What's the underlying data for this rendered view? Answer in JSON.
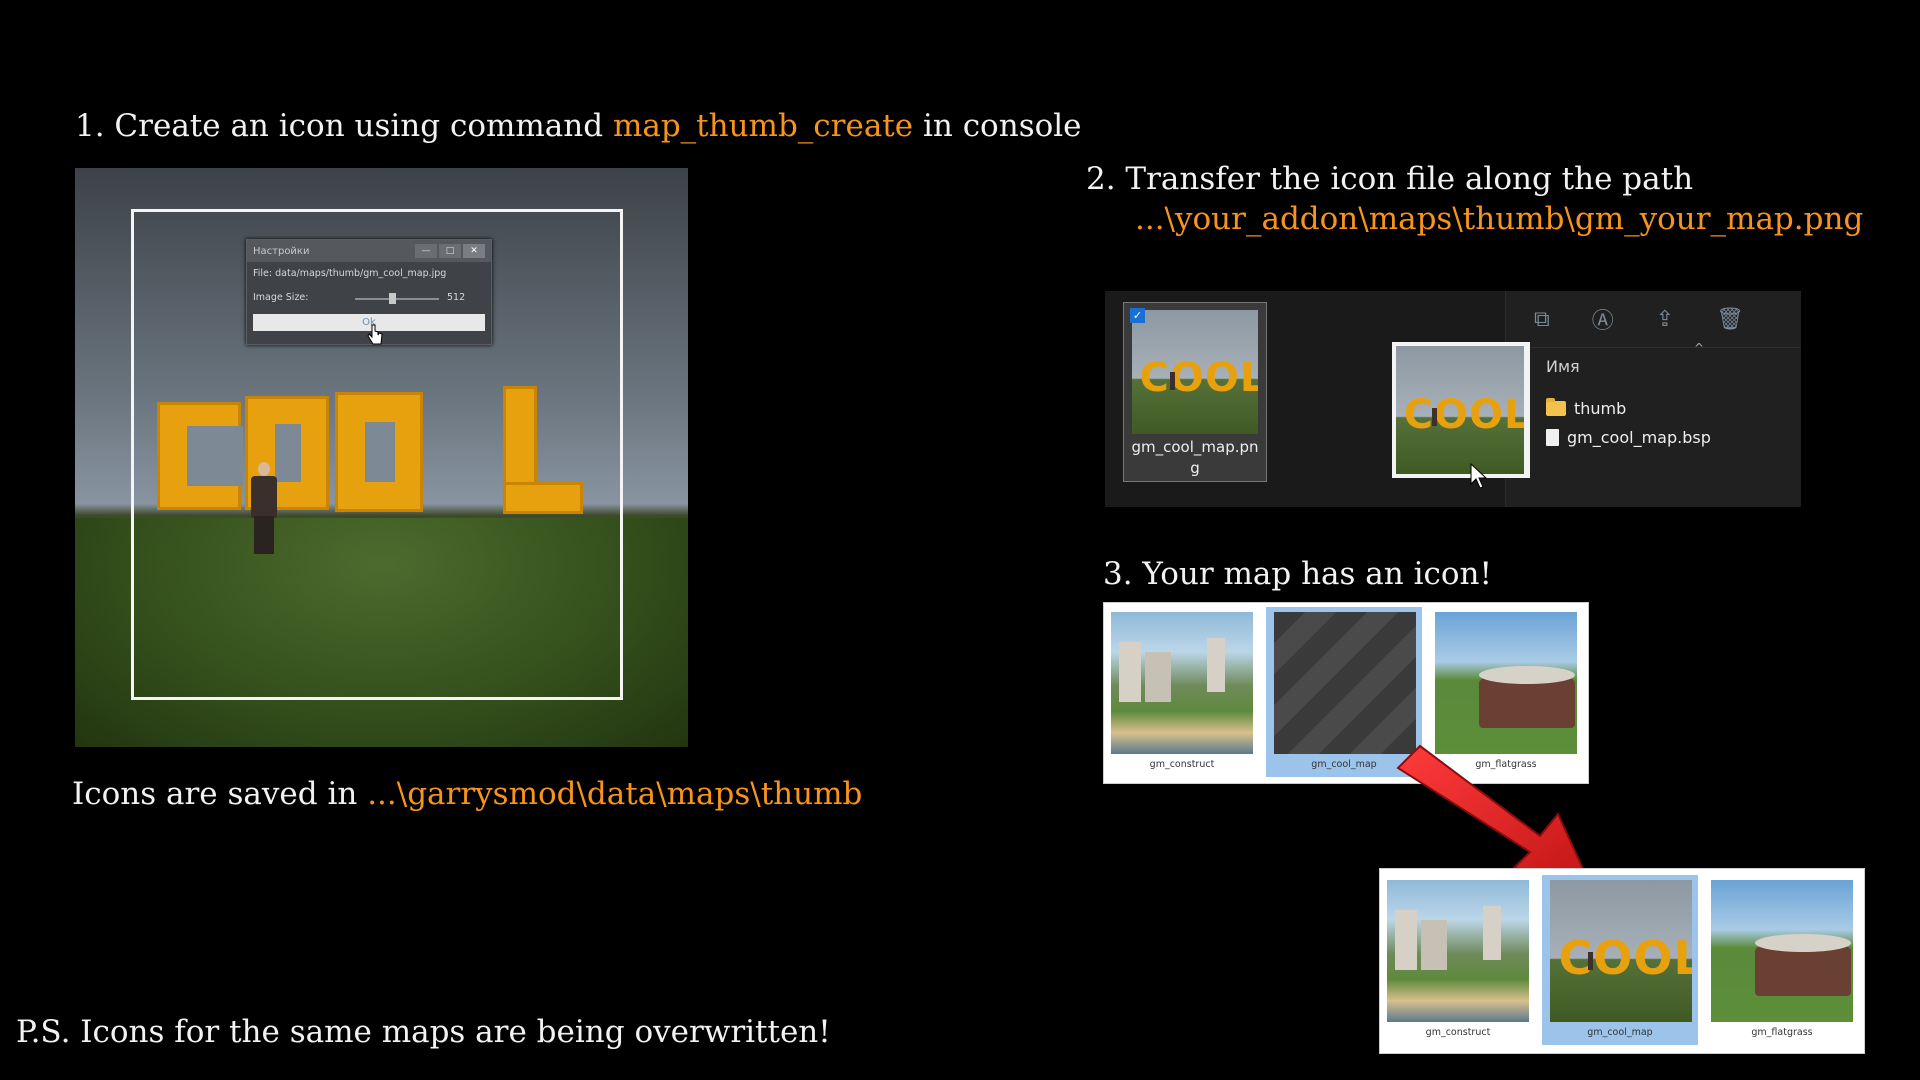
{
  "step1": {
    "prefix": "1. Create an icon using command ",
    "command": "map_thumb_create",
    "suffix": " in console"
  },
  "dialog": {
    "title": "Настройки",
    "file_label": "File: data/maps/thumb/gm_cool_map.jpg",
    "size_label": "Image Size:",
    "size_value": "512",
    "ok_label": "Ok",
    "minimize": "—",
    "maximize": "□",
    "close": "✕"
  },
  "scene_word": "COOL",
  "saved": {
    "prefix": "Icons are saved in ",
    "path": "...\\garrysmod\\data\\maps\\thumb"
  },
  "step2": {
    "line1": "2. Transfer the icon file along the path",
    "path": "...\\your_addon\\maps\\thumb\\gm_your_map.png"
  },
  "explorer": {
    "selected_file": "gm_cool_map.png",
    "check": "✓",
    "column_header": "Имя",
    "items": [
      {
        "name": "thumb",
        "type": "folder"
      },
      {
        "name": "gm_cool_map.bsp",
        "type": "file"
      }
    ],
    "toolbar_icons": [
      "copy-icon",
      "rename-icon",
      "share-icon",
      "delete-icon"
    ],
    "toolbar_glyphs": [
      "⧉",
      "Ⓐ",
      "⇪",
      "🗑"
    ]
  },
  "step3": {
    "label": "3. Your map has an icon!"
  },
  "maps_before": [
    "gm_construct",
    "gm_cool_map",
    "gm_flatgrass"
  ],
  "maps_after": [
    "gm_construct",
    "gm_cool_map",
    "gm_flatgrass"
  ],
  "ps": "P.S. Icons for the same maps are being overwritten!",
  "colors": {
    "accent": "#f7941d",
    "cool_yellow": "#e8a10e",
    "arrow_red": "#e32222",
    "selection_blue": "#9cc3ea"
  }
}
